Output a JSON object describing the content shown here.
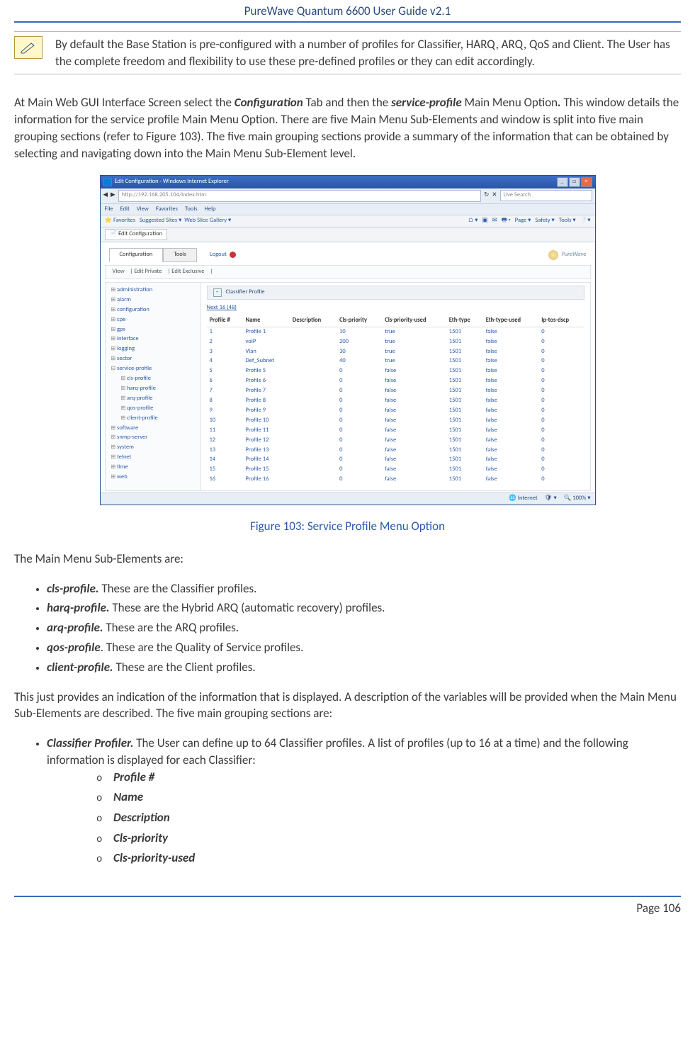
{
  "header": {
    "title": "PureWave Quantum 6600 User Guide v2.1"
  },
  "note": {
    "text": "By default the Base Station is pre-configured with a number of profiles for Classifier, HARQ, ARQ, QoS and Client. The User has the complete freedom and flexibility to use these pre-defined profiles or they can edit accordingly."
  },
  "intro": {
    "p1_a": "At Main Web GUI Interface Screen select the ",
    "p1_b": "Configuration",
    "p1_c": " Tab and then the ",
    "p1_d": "service-profile",
    "p1_e": " Main Menu Option",
    "p1_f": ".",
    "p1_g": " This window details the information for the service profile Main Menu Option. There are five Main Menu Sub-Elements and window is split into five main grouping sections (refer to ",
    "p1_h": "Figure 103",
    "p1_i": "). The five main grouping sections provide a summary of the information that can be obtained by selecting and navigating down into the Main Menu Sub-Element level."
  },
  "screenshot": {
    "title": "Edit Configuration - Windows Internet Explorer",
    "addr": "http://192.168.205.104/index.htm",
    "search": "Live Search",
    "menu": [
      "File",
      "Edit",
      "View",
      "Favorites",
      "Tools",
      "Help"
    ],
    "favlabel": "Favorites",
    "favsug": "Suggested Sites ▾",
    "favgal": "Web Slice Gallery ▾",
    "favright": [
      "Page ▾",
      "Safety ▾",
      "Tools ▾"
    ],
    "ietab": "Edit Configuration",
    "app_tabs": {
      "config": "Configuration",
      "tools": "Tools"
    },
    "logout": "Logout",
    "logo": "PureWave",
    "subbar": [
      "View",
      "Edit Private",
      "Edit Exclusive"
    ],
    "tree": {
      "items": [
        "administration",
        "alarm",
        "configuration",
        "cpe",
        "gps",
        "interface",
        "logging",
        "sector",
        "service-profile"
      ],
      "sub": [
        "cls-profile",
        "harq-profile",
        "arq-profile",
        "qos-profile",
        "client-profile"
      ],
      "items2": [
        "software",
        "snmp-server",
        "system",
        "telnet",
        "time",
        "web"
      ]
    },
    "section": "Classifier Profile",
    "pager": "Next 16 (48)",
    "headers": [
      "Profile #",
      "Name",
      "Description",
      "Cls-priority",
      "Cls-priority-used",
      "Eth-type",
      "Eth-type-used",
      "Ip-tos-dscp"
    ],
    "rows": [
      [
        "1",
        "Profile 1",
        "",
        "10",
        "true",
        "1501",
        "false",
        "0"
      ],
      [
        "2",
        "voIP",
        "",
        "200",
        "true",
        "1501",
        "false",
        "0"
      ],
      [
        "3",
        "Vlan",
        "",
        "30",
        "true",
        "1501",
        "false",
        "0"
      ],
      [
        "4",
        "Def_Subnet",
        "",
        "40",
        "true",
        "1501",
        "false",
        "0"
      ],
      [
        "5",
        "Profile 5",
        "",
        "0",
        "false",
        "1501",
        "false",
        "0"
      ],
      [
        "6",
        "Profile 6",
        "",
        "0",
        "false",
        "1501",
        "false",
        "0"
      ],
      [
        "7",
        "Profile 7",
        "",
        "0",
        "false",
        "1501",
        "false",
        "0"
      ],
      [
        "8",
        "Profile 8",
        "",
        "0",
        "false",
        "1501",
        "false",
        "0"
      ],
      [
        "9",
        "Profile 9",
        "",
        "0",
        "false",
        "1501",
        "false",
        "0"
      ],
      [
        "10",
        "Profile 10",
        "",
        "0",
        "false",
        "1501",
        "false",
        "0"
      ],
      [
        "11",
        "Profile 11",
        "",
        "0",
        "false",
        "1501",
        "false",
        "0"
      ],
      [
        "12",
        "Profile 12",
        "",
        "0",
        "false",
        "1501",
        "false",
        "0"
      ],
      [
        "13",
        "Profile 13",
        "",
        "0",
        "false",
        "1501",
        "false",
        "0"
      ],
      [
        "14",
        "Profile 14",
        "",
        "0",
        "false",
        "1501",
        "false",
        "0"
      ],
      [
        "15",
        "Profile 15",
        "",
        "0",
        "false",
        "1501",
        "false",
        "0"
      ],
      [
        "16",
        "Profile 16",
        "",
        "0",
        "false",
        "1501",
        "false",
        "0"
      ]
    ],
    "status_internet": "Internet",
    "status_zoom": "100%"
  },
  "caption": "Figure 103: Service Profile Menu Option",
  "body": {
    "sub_intro": "The Main Menu Sub-Elements are:",
    "subs": [
      {
        "term": "cls-profile.",
        "desc": " These are the Classifier profiles."
      },
      {
        "term": "harq-profile.",
        "desc": " These are the Hybrid ARQ (automatic recovery) profiles."
      },
      {
        "term": "arq-profile.",
        "desc": " These are the ARQ profiles."
      },
      {
        "term": "qos-profile",
        "dot": ". ",
        "desc": "These are the Quality of Service profiles."
      },
      {
        "term": "client-profile.",
        "desc": " These are the Client profiles."
      }
    ],
    "para2": "This just provides an indication of the information that is displayed. A description of the variables will be provided when the Main Menu Sub-Elements are described. The five main grouping sections are:",
    "classifier": {
      "term": "Classifier Profiler.",
      "desc": " The User can define up to 64 Classifier profiles. A list of profiles (up to 16 at a time) and the following information is displayed for each Classifier:",
      "fields": [
        "Profile #",
        "Name",
        "Description",
        "Cls-priority",
        "Cls-priority-used"
      ]
    }
  },
  "footer": {
    "page": "Page 106"
  }
}
